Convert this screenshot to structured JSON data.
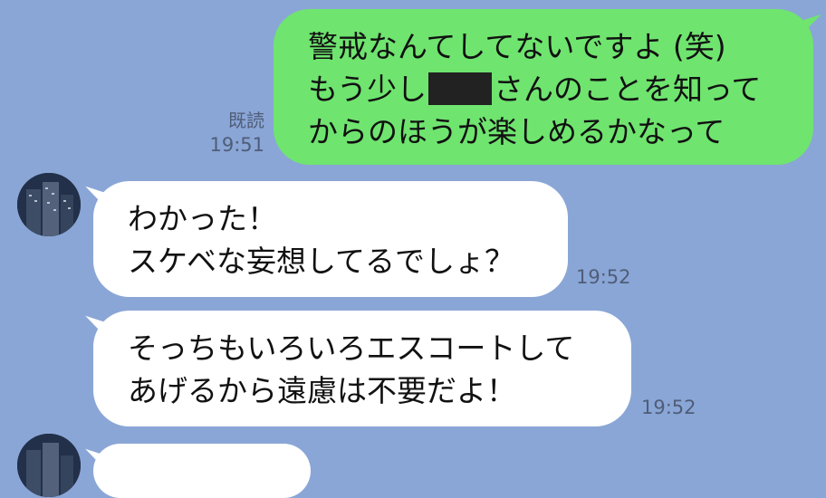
{
  "messages": {
    "outgoing": {
      "lines": [
        "警戒なんてしてないですよ (笑)",
        "もう少し",
        "さんのことを知って",
        "からのほうが楽しめるかなって"
      ],
      "read_label": "既読",
      "time": "19:51"
    },
    "incoming1": {
      "lines": [
        "わかった！",
        "スケベな妄想してるでしょ？"
      ],
      "time": "19:52"
    },
    "incoming2": {
      "lines": [
        "そっちもいろいろエスコートして",
        "あげるから遠慮は不要だよ！"
      ],
      "time": "19:52"
    }
  },
  "icons": {
    "avatar": "contact-avatar-city-night",
    "redaction": "redacted-name-block"
  },
  "colors": {
    "background": "#8aa6d6",
    "outgoing_bubble": "#6fe46f",
    "incoming_bubble": "#ffffff",
    "meta_text": "#4f5d78"
  }
}
